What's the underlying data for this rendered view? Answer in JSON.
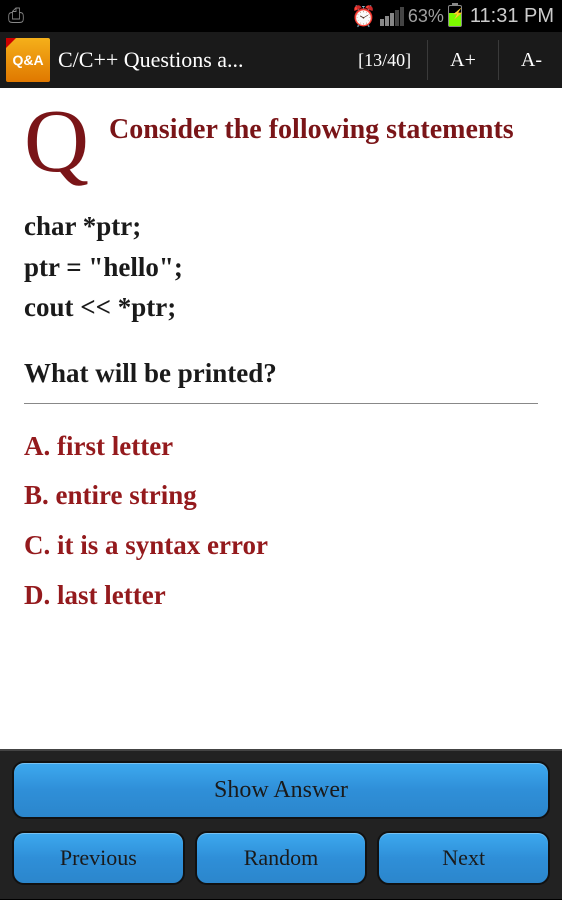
{
  "status": {
    "battery_pct": "63%",
    "time": "11:31 PM"
  },
  "app": {
    "icon_text": "Q&A",
    "title": "C/C++ Questions a...",
    "counter": "[13/40]",
    "font_inc": "A+",
    "font_dec": "A-"
  },
  "question": {
    "marker": "Q",
    "prompt": "Consider the following statements",
    "code_lines": [
      "char *ptr;",
      "ptr = \"hello\";",
      "cout << *ptr;"
    ],
    "ask": "What will be printed?",
    "options": [
      "A. first letter",
      "B. entire string",
      "C. it is a syntax error",
      "D. last letter"
    ]
  },
  "buttons": {
    "show_answer": "Show Answer",
    "previous": "Previous",
    "random": "Random",
    "next": "Next"
  }
}
